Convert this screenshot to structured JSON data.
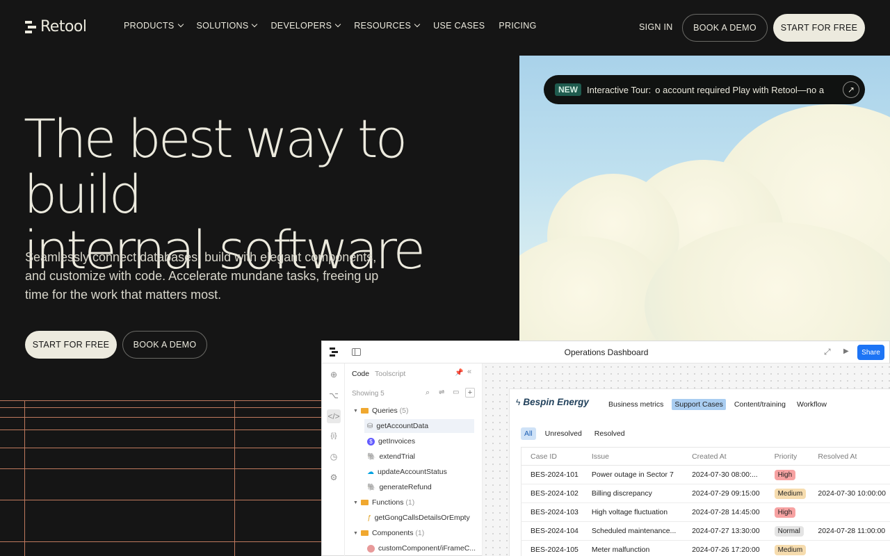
{
  "nav": {
    "logo_text": "Retool",
    "menu": [
      {
        "label": "PRODUCTS",
        "dropdown": true
      },
      {
        "label": "SOLUTIONS",
        "dropdown": true
      },
      {
        "label": "DEVELOPERS",
        "dropdown": true
      },
      {
        "label": "RESOURCES",
        "dropdown": true
      },
      {
        "label": "USE CASES",
        "dropdown": false
      },
      {
        "label": "PRICING",
        "dropdown": false
      }
    ],
    "sign_in": "SIGN IN",
    "book_demo": "BOOK A DEMO",
    "start_free": "START FOR FREE"
  },
  "hero": {
    "title_line1": "The best way to build",
    "title_line2": "internal software",
    "subtitle": "Seamlessly connect databases, build with elegant components, and customize with code. Accelerate mundane tasks, freeing up time for the work that matters most.",
    "start_free": "START FOR FREE",
    "book_demo": "BOOK A DEMO"
  },
  "tour": {
    "badge": "NEW",
    "label": "Interactive Tour:",
    "marquee": "o account required    Play with Retool—no a"
  },
  "dashboard": {
    "title": "Operations Dashboard",
    "share": "Share",
    "sidebar": {
      "tab_code": "Code",
      "tab_toolscript": "Toolscript",
      "showing": "Showing 5",
      "queries_label": "Queries",
      "queries_count": "(5)",
      "queries": [
        "getAccountData",
        "getInvoices",
        "extendTrial",
        "updateAccountStatus",
        "generateRefund"
      ],
      "functions_label": "Functions",
      "functions_count": "(1)",
      "functions": [
        "getGongCallsDetailsOrEmpty"
      ],
      "components_label": "Components",
      "components_count": "(1)",
      "components": [
        "customComponent/iFrameC..."
      ]
    },
    "app": {
      "brand": "Bespin Energy",
      "tabs": [
        "Business metrics",
        "Support Cases",
        "Content/training",
        "Workflow"
      ],
      "active_tab": "Support Cases",
      "filters": [
        "All",
        "Unresolved",
        "Resolved"
      ],
      "columns": [
        "Case ID",
        "Issue",
        "Created At",
        "Priority",
        "Resolved At"
      ],
      "rows": [
        {
          "id": "BES-2024-101",
          "issue": "Power outage in Sector 7",
          "created": "2024-07-30 08:00:...",
          "priority": "High",
          "resolved": ""
        },
        {
          "id": "BES-2024-102",
          "issue": "Billing discrepancy",
          "created": "2024-07-29 09:15:00",
          "priority": "Medium",
          "resolved": "2024-07-30 10:00:00"
        },
        {
          "id": "BES-2024-103",
          "issue": "High voltage fluctuation",
          "created": "2024-07-28 14:45:00",
          "priority": "High",
          "resolved": ""
        },
        {
          "id": "BES-2024-104",
          "issue": "Scheduled maintenance...",
          "created": "2024-07-27 13:30:00",
          "priority": "Normal",
          "resolved": "2024-07-28 11:00:00"
        },
        {
          "id": "BES-2024-105",
          "issue": "Meter malfunction",
          "created": "2024-07-26 17:20:00",
          "priority": "Medium",
          "resolved": ""
        }
      ]
    }
  },
  "colors": {
    "background": "#151515",
    "text": "#eceade",
    "accent_button": "#eceade",
    "grid_lines": "#c07a5e",
    "share_blue": "#1d74f5",
    "priority_high": "#f7a2a2",
    "priority_medium": "#f6dcae",
    "priority_normal": "#e4e4e4"
  }
}
